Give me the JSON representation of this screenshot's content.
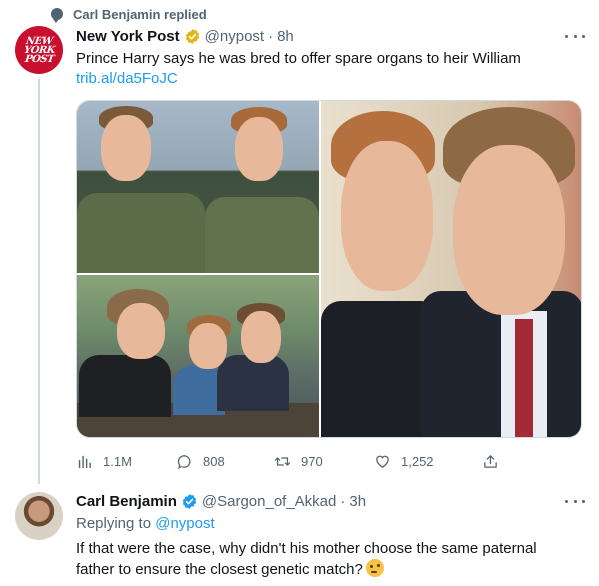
{
  "context": {
    "text": "Carl Benjamin replied",
    "icon": "reply-bubble-icon"
  },
  "tweet": {
    "avatar_text": [
      "NEW",
      "YORK",
      "POST"
    ],
    "name": "New York Post",
    "handle": "@nypost",
    "separator": "·",
    "time": "8h",
    "text": "Prince Harry says he was bred to offer spare organs to heir William",
    "link": "trib.al/da5FoJC",
    "stats": {
      "views": "1.1M",
      "replies": "808",
      "retweets": "970",
      "likes": "1,252"
    }
  },
  "reply": {
    "name": "Carl Benjamin",
    "handle": "@Sargon_of_Akkad",
    "separator": "·",
    "time": "3h",
    "replying_prefix": "Replying to",
    "replying_to": "@nypost",
    "text": "If that were the case, why didn't  his mother choose the same paternal father to ensure the closest genetic match?"
  },
  "colors": {
    "accent": "#1d9bf0",
    "muted": "#536471",
    "gold_badge": "#e2b719",
    "blue_badge": "#1d9bf0",
    "nyp_red": "#c8102e"
  }
}
